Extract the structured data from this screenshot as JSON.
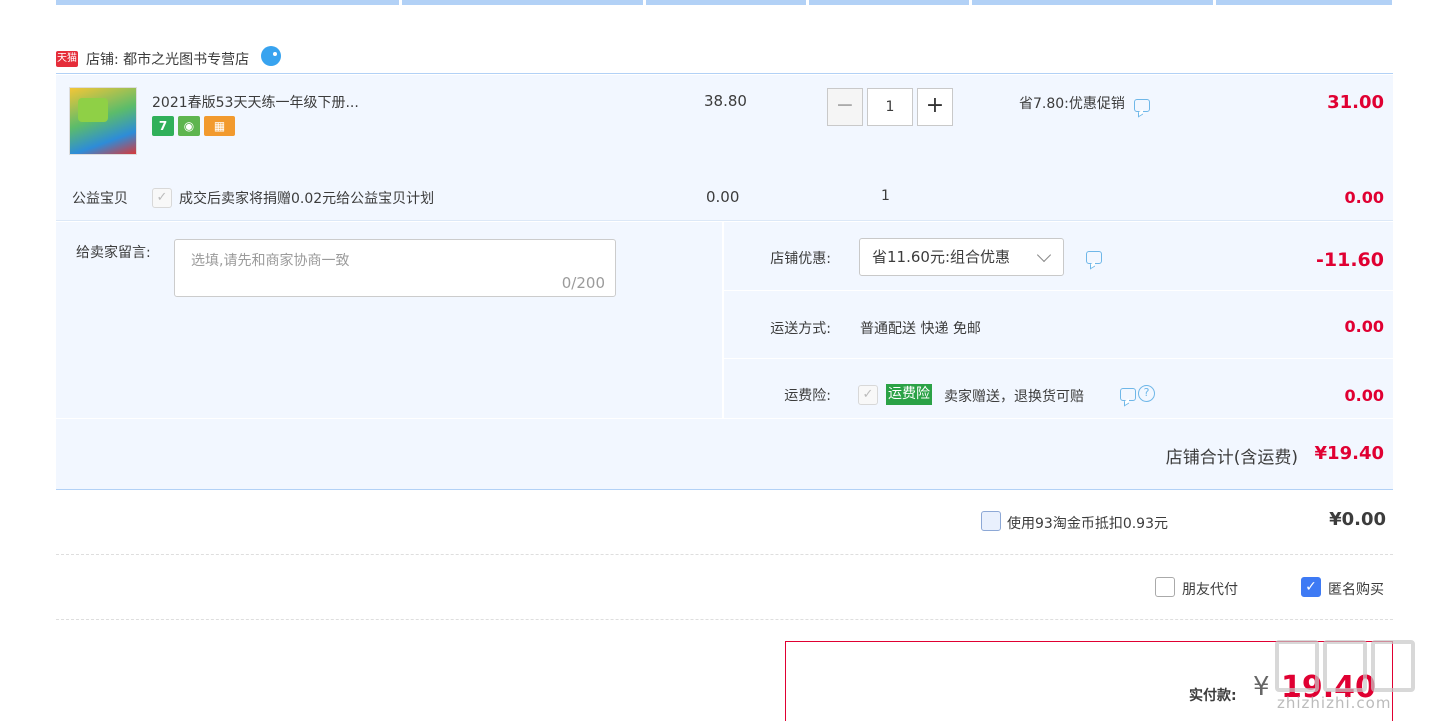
{
  "shop": {
    "badge": "天猫",
    "label": "店铺: 都市之光图书专营店"
  },
  "item": {
    "title": "2021春版53天天练一年级下册...",
    "badge_7": "7",
    "unit_price": "38.80",
    "quantity": "1",
    "qty_minus": "−",
    "qty_plus": "+",
    "promo": "省7.80:优惠促销",
    "total": "31.00"
  },
  "charity": {
    "label": "公益宝贝",
    "description": "成交后卖家将捐赠0.02元给公益宝贝计划",
    "price": "0.00",
    "quantity": "1",
    "total": "0.00"
  },
  "message": {
    "label": "给卖家留言:",
    "placeholder": "选填,请先和商家协商一致",
    "counter": "0/200"
  },
  "discount": {
    "label": "店铺优惠:",
    "selected": "省11.60元:组合优惠",
    "value": "-11.60"
  },
  "shipping": {
    "label": "运送方式:",
    "text": "普通配送 快递 免邮",
    "value": "0.00"
  },
  "insurance": {
    "label": "运费险:",
    "badge": "运费险",
    "text": "卖家赠送，退换货可赔",
    "help": "?",
    "value": "0.00"
  },
  "shop_total": {
    "label": "店铺合计(含运费)",
    "value": "¥19.40"
  },
  "coins": {
    "text": "使用93淘金币抵扣0.93元",
    "value": "¥0.00",
    "checked": false
  },
  "options": {
    "friend_pay": "朋友代付",
    "anonymous": "匿名购买",
    "anonymous_checked": true
  },
  "payment": {
    "label": "实付款:",
    "currency": "¥",
    "value": "19.40"
  },
  "watermark": {
    "text": "zhizhizhi.com"
  },
  "colors": {
    "accent_red": "#e00032",
    "panel_bg": "#f2f7ff",
    "border_blue": "#b2d1f6",
    "tmall_red": "#e52d3a",
    "insurance_green": "#2ba246",
    "check_blue": "#3e7af4"
  }
}
